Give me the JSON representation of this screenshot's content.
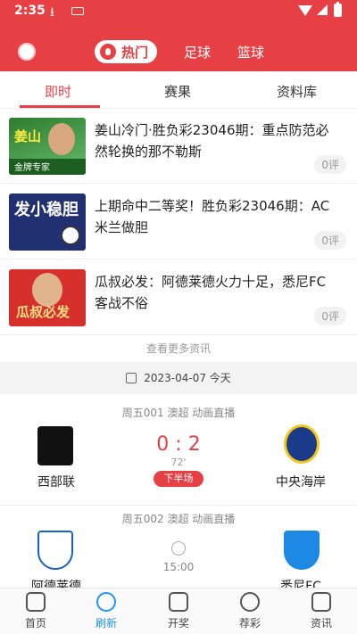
{
  "status_bar": {
    "time": "2:35"
  },
  "header": {
    "tabs": [
      {
        "label": "热门"
      },
      {
        "label": "足球"
      },
      {
        "label": "篮球"
      }
    ]
  },
  "subtabs": [
    {
      "label": "即时"
    },
    {
      "label": "赛果"
    },
    {
      "label": "资料库"
    }
  ],
  "news": [
    {
      "title": "姜山冷门·胜负彩23046期：重点防范必然轮换的那不勒斯",
      "comments": "0评",
      "thumb_text": "姜山",
      "thumb_sub": "金牌专家"
    },
    {
      "title": "上期命中二等奖！胜负彩23046期：AC米兰做胆",
      "comments": "0评",
      "thumb_text": "发小稳胆"
    },
    {
      "title": "瓜叔必发：阿德莱德火力十足，悉尼FC客战不俗",
      "comments": "0评",
      "thumb_text": "瓜叔必发"
    }
  ],
  "more_label": "查看更多资讯",
  "date_bar": "2023-04-07 今天",
  "matches": [
    {
      "header": "周五001 澳超 动画直播",
      "home": "西部联",
      "away": "中央海岸",
      "score": "0 : 2",
      "minute": "72'",
      "status": "下半场"
    },
    {
      "header": "周五002 澳超 动画直播",
      "home": "阿德莱德",
      "away": "悉尼FC",
      "time": "15:00"
    }
  ],
  "bottom_nav": [
    {
      "label": "首页",
      "icon": "home-icon"
    },
    {
      "label": "刷新",
      "icon": "refresh-icon"
    },
    {
      "label": "开奖",
      "icon": "trophy-icon"
    },
    {
      "label": "荐彩",
      "icon": "ball-8-icon"
    },
    {
      "label": "资讯",
      "icon": "news-icon"
    }
  ],
  "colors": {
    "accent": "#e64045",
    "active_nav": "#2196f3"
  }
}
